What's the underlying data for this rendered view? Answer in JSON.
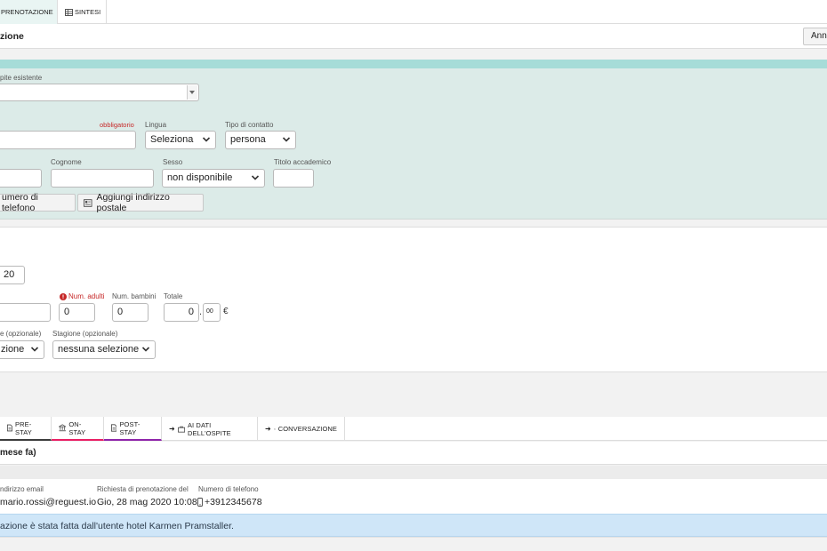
{
  "top_tabs": [
    {
      "label": "PRENOTAZIONE"
    },
    {
      "label": "SINTESI"
    }
  ],
  "header": {
    "title": "zione",
    "action_label": "Ann"
  },
  "guest": {
    "existing_label": "pite esistente",
    "required_label": "obbligatorio",
    "lingua_label": "Lingua",
    "lingua_value": "Seleziona",
    "tipo_contatto_label": "Tipo di contatto",
    "tipo_contatto_value": "persona",
    "cognome_label": "Cognome",
    "sesso_label": "Sesso",
    "sesso_value": "non disponibile",
    "titolo_label": "Titolo accademico",
    "phone_button": "umero di telefono",
    "address_button": "Aggiungi indirizzo postale"
  },
  "booking": {
    "date_partial": "20",
    "adulti_label": "Num. adulti",
    "adulti_value": "0",
    "bambini_label": "Num. bambini",
    "bambini_value": "0",
    "totale_label": "Totale",
    "totale_int": "0",
    "totale_dec": "00",
    "totale_sep": ".",
    "currency": "€",
    "opt1_label": "e (opzionale)",
    "opt1_value": "zione",
    "stagione_label": "Stagione (opzionale)",
    "stagione_value": "nessuna selezione"
  },
  "bottom_tabs": [
    {
      "label": "PRE-STAY",
      "icon": "document-icon",
      "color": "#3c3c3c"
    },
    {
      "label": "ON-STAY",
      "icon": "bank-icon",
      "color": "#e91e63"
    },
    {
      "label": "POST-STAY",
      "icon": "document-icon",
      "color": "#8e24aa"
    },
    {
      "label": "AI DATI DELL'OSPITE",
      "prefix": "➜",
      "icon": "briefcase-icon"
    },
    {
      "label": "CONVERSAZIONE",
      "prefix": "➜",
      "icon": "chat-icon"
    }
  ],
  "request": {
    "heading": "mese fa)",
    "email_label": "ndirizzo email",
    "email_value": "mario.rossi@reguest.io",
    "date_label": "Richiesta di prenotazione del",
    "date_value": "Gio, 28 mag 2020 10:08",
    "phone_label": "Numero di telefono",
    "phone_value": "+3912345678",
    "note": "azione è stata fatta dall'utente hotel Karmen Pramstaller."
  },
  "colors": {
    "teal_bar": "#a6dcd8",
    "teal_panel": "#dcebe8",
    "required": "#c62828",
    "info_bg": "#cfe6f8"
  }
}
